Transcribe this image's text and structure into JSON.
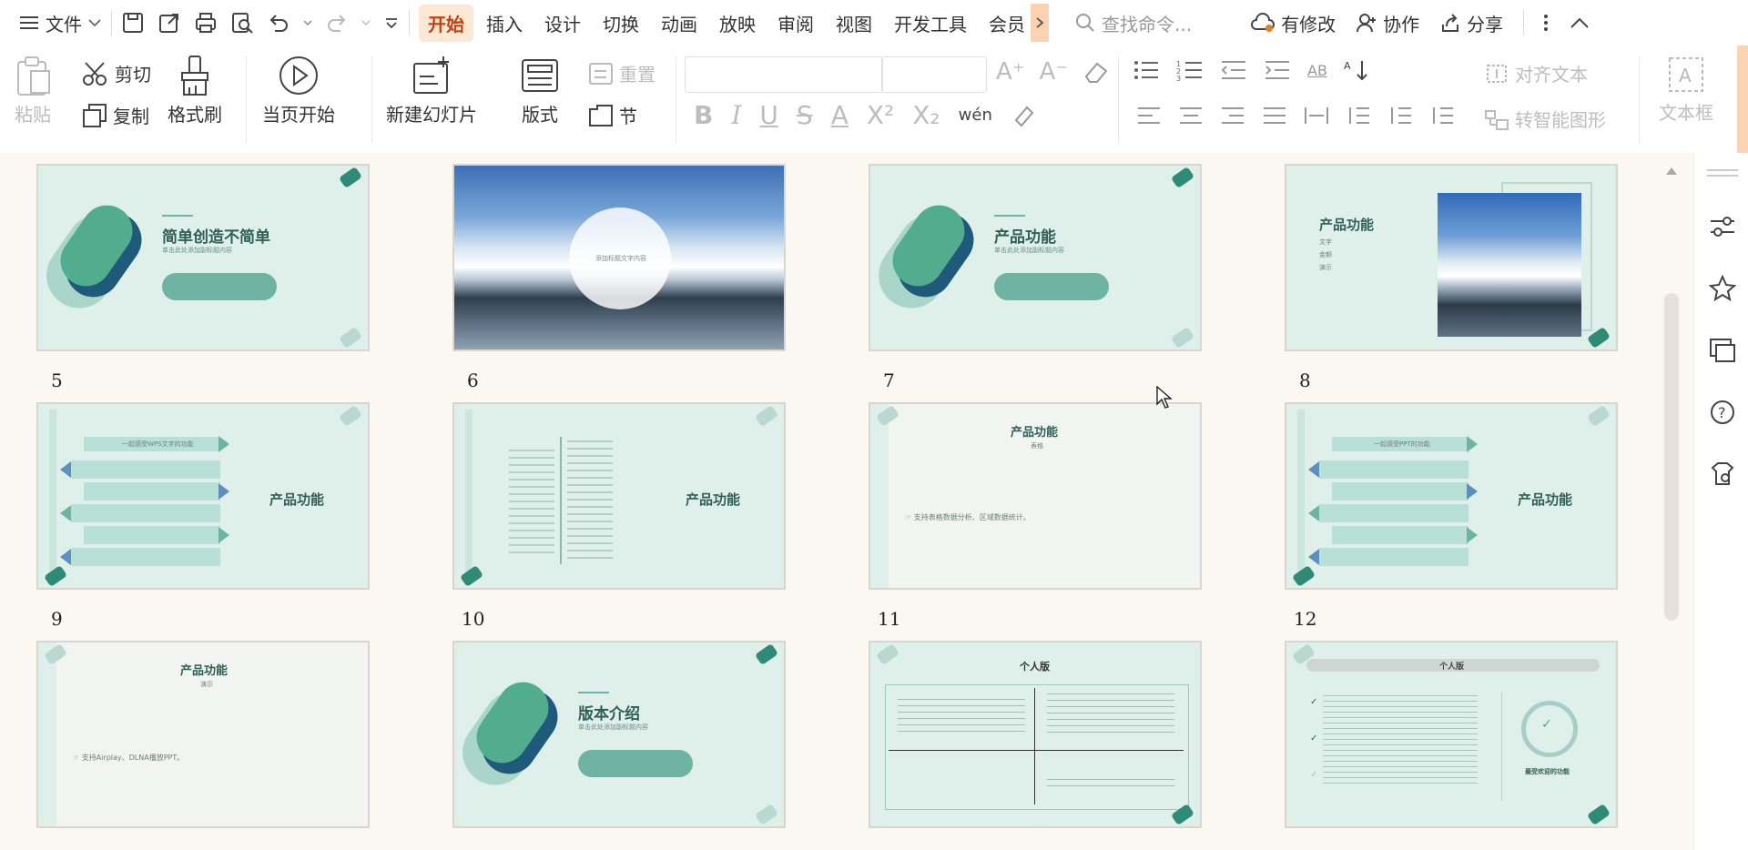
{
  "menubar": {
    "file_label": "文件",
    "tabs": [
      {
        "label": "开始",
        "active": true
      },
      {
        "label": "插入"
      },
      {
        "label": "设计"
      },
      {
        "label": "切换"
      },
      {
        "label": "动画"
      },
      {
        "label": "放映"
      },
      {
        "label": "审阅"
      },
      {
        "label": "视图"
      },
      {
        "label": "开发工具"
      },
      {
        "label": "会员"
      }
    ],
    "search_placeholder": "查找命令...",
    "has_changes_label": "有修改",
    "collaborate_label": "协作",
    "share_label": "分享"
  },
  "ribbon": {
    "paste": "粘贴",
    "cut": "剪切",
    "copy": "复制",
    "format_painter": "格式刷",
    "play_from_current": "当页开始",
    "new_slide": "新建幻灯片",
    "layout": "版式",
    "reset": "重置",
    "section": "节",
    "align_text": "对齐文本",
    "smart_shape": "转智能图形",
    "text_box": "文本框"
  },
  "slides": [
    {
      "id": 4,
      "number": "",
      "title": "简单创造不简单",
      "subtitle": "单击此处添加副标题内容",
      "pill": "▪▪"
    },
    {
      "id": 5,
      "number": "5",
      "circle_text": "添加标题文字内容"
    },
    {
      "id": 6,
      "number": "6",
      "title": "产品功能",
      "subtitle": "单击此处添加副标题内容",
      "pill": "▪▪"
    },
    {
      "id": 7,
      "number": "7",
      "title": "产品功能",
      "list": [
        "文字",
        "金额",
        "演示"
      ]
    },
    {
      "id": 8,
      "number": "8",
      "title": "产品功能",
      "header": "一起感受WPS文字的功能"
    },
    {
      "id": 9,
      "number": "9",
      "title": "产品功能"
    },
    {
      "id": 10,
      "number": "10",
      "title": "产品功能",
      "subtitle": "表格",
      "bullet": "☞ 支持表格数据分析、区域数据统计。"
    },
    {
      "id": 11,
      "number": "11",
      "title": "产品功能",
      "header": "一起感受PPT的功能"
    },
    {
      "id": 12,
      "number": "12",
      "title": "产品功能",
      "subtitle": "演示",
      "bullet": "☞ 支持Airplay、DLNA播放PPT。"
    },
    {
      "id": 13,
      "number": "",
      "title": "版本介绍",
      "subtitle": "单击此处添加副标题内容",
      "pill": "▪▪"
    },
    {
      "id": 14,
      "number": "",
      "title": "个人版"
    },
    {
      "id": 15,
      "number": "",
      "title": "个人版",
      "side_title": "最受欢迎的功能"
    }
  ]
}
